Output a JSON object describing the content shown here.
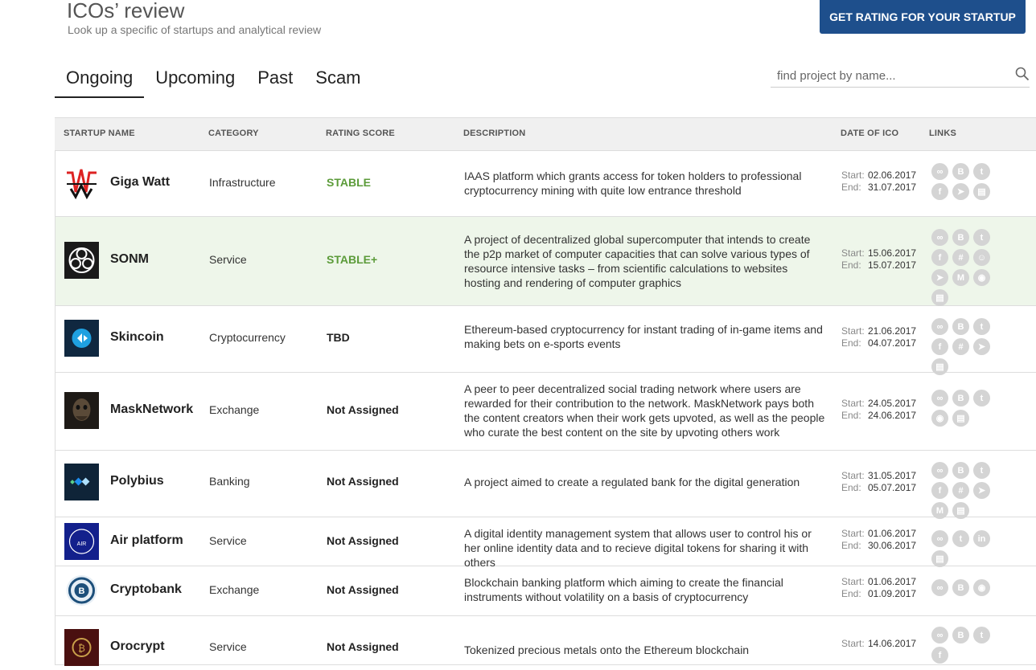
{
  "header": {
    "title": "ICOs’ review",
    "subtitle": "Look up a specific of startups and analytical review",
    "cta_label": "GET RATING FOR YOUR STARTUP"
  },
  "tabs": [
    {
      "label": "Ongoing",
      "active": true
    },
    {
      "label": "Upcoming",
      "active": false
    },
    {
      "label": "Past",
      "active": false
    },
    {
      "label": "Scam",
      "active": false
    }
  ],
  "search": {
    "placeholder": "find project by name...",
    "value": ""
  },
  "table": {
    "columns": [
      "STARTUP NAME",
      "CATEGORY",
      "RATING SCORE",
      "DESCRIPTION",
      "DATE OF ICO",
      "LINKS"
    ],
    "start_label": "Start:",
    "end_label": "End:",
    "rows": [
      {
        "name": "Giga Watt",
        "category": "Infrastructure",
        "score": "STABLE",
        "description": "IAAS platform which grants access for token holders to professional cryptocurrency mining with quite low entrance threshold",
        "start": "02.06.2017",
        "end": "31.07.2017",
        "links": [
          "link-icon",
          "bitcoin-icon",
          "twitter-icon",
          "facebook-icon",
          "telegram-icon",
          "document-icon"
        ]
      },
      {
        "name": "SONM",
        "category": "Service",
        "score": "STABLE+",
        "description": "A project of decentralized global supercomputer that intends to create the p2p market of computer capacities that can solve various types of resource intensive tasks – from scientific calculations to websites hosting and rendering of computer graphics",
        "start": "15.06.2017",
        "end": "15.07.2017",
        "links": [
          "link-icon",
          "bitcoin-icon",
          "twitter-icon",
          "facebook-icon",
          "slack-icon",
          "reddit-icon",
          "telegram-icon",
          "medium-icon",
          "github-icon",
          "document-icon"
        ]
      },
      {
        "name": "Skincoin",
        "category": "Cryptocurrency",
        "score": "TBD",
        "description": "Ethereum-based cryptocurrency for instant trading of in-game items and making bets on e-sports events",
        "start": "21.06.2017",
        "end": "04.07.2017",
        "links": [
          "link-icon",
          "bitcoin-icon",
          "twitter-icon",
          "facebook-icon",
          "slack-icon",
          "telegram-icon",
          "document-icon"
        ]
      },
      {
        "name": "MaskNetwork",
        "category": "Exchange",
        "score": "Not Assigned",
        "description": "A peer to peer decentralized social trading network where users are rewarded for their contribution to the network. MaskNetwork pays both the content creators when their work gets upvoted, as well as the people who curate the best content on the site by upvoting others work",
        "start": "24.05.2017",
        "end": "24.06.2017",
        "links": [
          "link-icon",
          "bitcoin-icon",
          "twitter-icon",
          "github-icon",
          "document-icon"
        ]
      },
      {
        "name": "Polybius",
        "category": "Banking",
        "score": "Not Assigned",
        "description": "A project aimed to create a regulated bank for the digital generation",
        "start": "31.05.2017",
        "end": "05.07.2017",
        "links": [
          "link-icon",
          "bitcoin-icon",
          "twitter-icon",
          "facebook-icon",
          "slack-icon",
          "telegram-icon",
          "medium-icon",
          "document-icon"
        ]
      },
      {
        "name": "Air platform",
        "category": "Service",
        "score": "Not Assigned",
        "description": "A digital identity management system that allows user to control his or her online identity data and to recieve digital tokens for sharing it with others",
        "start": "01.06.2017",
        "end": "30.06.2017",
        "links": [
          "link-icon",
          "twitter-icon",
          "linkedin-icon",
          "document-icon"
        ]
      },
      {
        "name": "Cryptobank",
        "category": "Exchange",
        "score": "Not Assigned",
        "description": "Blockchain banking platform which aiming to create the financial instruments without volatility on a basis of cryptocurrency",
        "start": "01.06.2017",
        "end": "01.09.2017",
        "links": [
          "link-icon",
          "bitcoin-icon",
          "github-icon"
        ]
      },
      {
        "name": "Orocrypt",
        "category": "Service",
        "score": "Not Assigned",
        "description": "Tokenized precious metals onto the Ethereum blockchain",
        "start": "14.06.2017",
        "end": "",
        "links": [
          "link-icon",
          "bitcoin-icon",
          "twitter-icon",
          "facebook-icon"
        ]
      }
    ]
  },
  "colors": {
    "accent": "#1e4f8c",
    "stable": "#5b9b39",
    "highlight_row": "#eef6ea"
  }
}
